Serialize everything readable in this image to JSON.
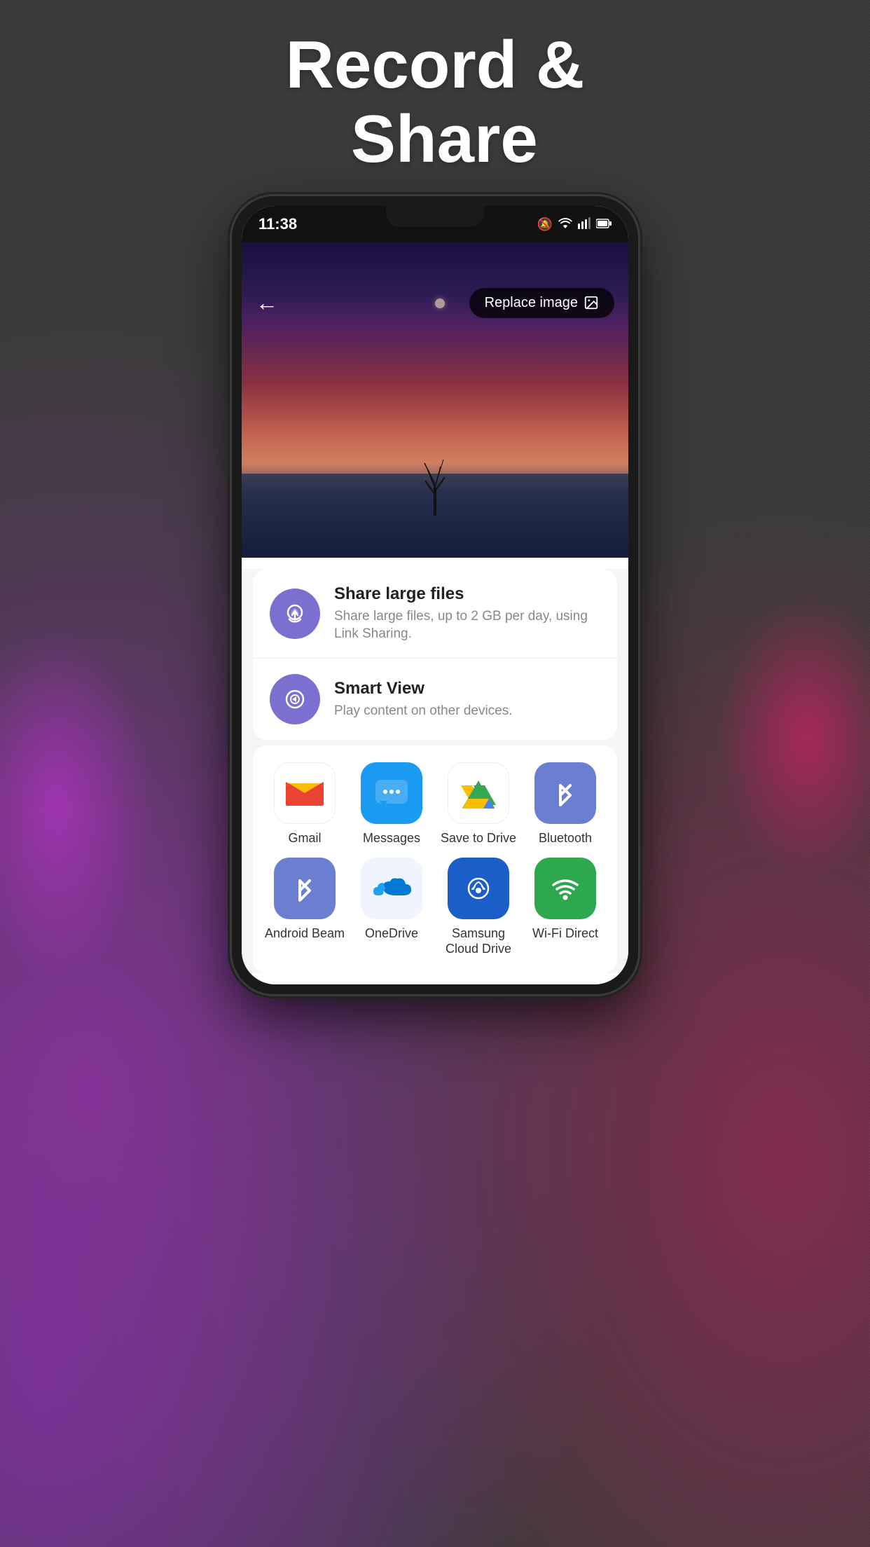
{
  "header": {
    "title": "Record &\nShare"
  },
  "status_bar": {
    "time": "11:38",
    "icons": "🔕 📶 📶 🔋"
  },
  "phone": {
    "toolbar": {
      "back_label": "←",
      "replace_image_label": "Replace image"
    },
    "share_items": [
      {
        "id": "share-large-files",
        "title": "Share large files",
        "description": "Share large files, up to 2 GB per day, using Link Sharing.",
        "icon": "cloud-upload"
      },
      {
        "id": "smart-view",
        "title": "Smart View",
        "description": "Play content on other devices.",
        "icon": "cast"
      }
    ],
    "apps": [
      {
        "id": "gmail",
        "label": "Gmail",
        "color": "gmail-bg"
      },
      {
        "id": "messages",
        "label": "Messages",
        "color": "messages-bg"
      },
      {
        "id": "save-to-drive",
        "label": "Save to Drive",
        "color": "drive-bg"
      },
      {
        "id": "bluetooth",
        "label": "Bluetooth",
        "color": "bluetooth-bg"
      },
      {
        "id": "android-beam",
        "label": "Android Beam",
        "color": "androidbeam-bg"
      },
      {
        "id": "onedrive",
        "label": "OneDrive",
        "color": "onedrive-bg"
      },
      {
        "id": "samsung-cloud-drive",
        "label": "Samsung Cloud Drive",
        "color": "samsung-bg"
      },
      {
        "id": "wifi-direct",
        "label": "Wi-Fi Direct",
        "color": "wifi-bg"
      }
    ]
  }
}
